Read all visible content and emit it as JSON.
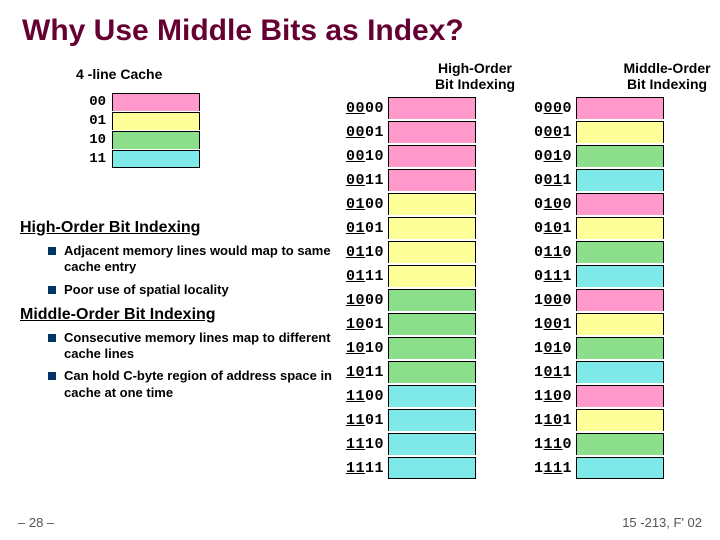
{
  "title": "Why Use Middle Bits as Index?",
  "cache": {
    "title": "4 -line Cache",
    "indices": [
      "00",
      "01",
      "10",
      "11"
    ],
    "colors": [
      "#ff99cc",
      "#ffff99",
      "#8bdf8b",
      "#7fe8e8"
    ]
  },
  "columns": {
    "high": {
      "title": "High-Order\nBit Indexing"
    },
    "mid": {
      "title": "Middle-Order\nBit Indexing"
    }
  },
  "addresses": [
    "0000",
    "0001",
    "0010",
    "0011",
    "0100",
    "0101",
    "0110",
    "0111",
    "1000",
    "1001",
    "1010",
    "1011",
    "1100",
    "1101",
    "1110",
    "1111"
  ],
  "high_colors": [
    0,
    0,
    0,
    0,
    1,
    1,
    1,
    1,
    2,
    2,
    2,
    2,
    3,
    3,
    3,
    3
  ],
  "mid_colors": [
    0,
    1,
    2,
    3,
    0,
    1,
    2,
    3,
    0,
    1,
    2,
    3,
    0,
    1,
    2,
    3
  ],
  "sections": {
    "high": {
      "heading": "High-Order Bit Indexing",
      "bullets": [
        "Adjacent memory lines would map to same cache entry",
        "Poor use of spatial locality"
      ]
    },
    "mid": {
      "heading": "Middle-Order Bit Indexing",
      "bullets": [
        "Consecutive memory lines map to different cache lines",
        "Can hold C-byte region of address space in cache at one time"
      ]
    }
  },
  "page_number": "– 28 –",
  "footer": "15 -213, F' 02"
}
